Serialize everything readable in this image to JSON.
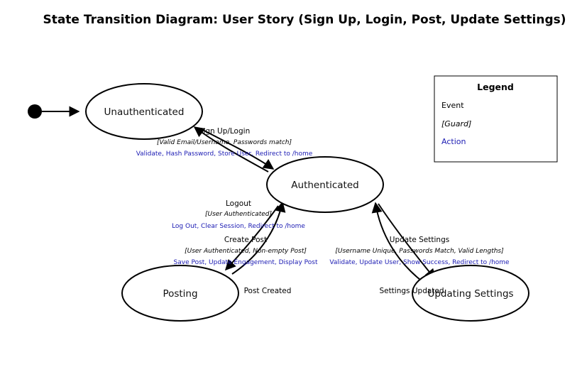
{
  "title": "State Transition Diagram: User Story (Sign Up, Login, Post, Update Settings)",
  "colors": {
    "action": "#1b1bb3",
    "stroke": "#000000",
    "background": "#ffffff"
  },
  "states": {
    "unauthenticated": "Unauthenticated",
    "authenticated": "Authenticated",
    "posting": "Posting",
    "updating": "Updating Settings"
  },
  "transitions": {
    "signup": {
      "event": "Sign Up/Login",
      "guard": "[Valid Email/Username, Passwords match]",
      "action": "Validate, Hash Password, Store User, Redirect to /home"
    },
    "logout": {
      "event": "Logout",
      "guard": "[User Authenticated]",
      "action": "Log Out, Clear Session, Redirect to /home"
    },
    "create_post": {
      "event": "Create Post",
      "guard": "[User Authenticated, Non-empty Post]",
      "action": "Save Post, Update Engagement, Display Post"
    },
    "post_created": {
      "event": "Post Created"
    },
    "update_settings": {
      "event": "Update Settings",
      "guard": "[Username Unique, Passwords Match, Valid Lengths]",
      "action": "Validate, Update User, Show Success, Redirect to /home"
    },
    "settings_updated": {
      "event": "Settings Updated"
    }
  },
  "legend": {
    "title": "Legend",
    "event": "Event",
    "guard": "[Guard]",
    "action": "Action"
  }
}
